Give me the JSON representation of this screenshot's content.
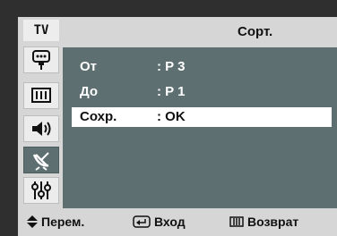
{
  "sidebar": {
    "source_label": "TV",
    "items": [
      {
        "icon": "picture-icon",
        "active": false
      },
      {
        "icon": "sound-icon",
        "active": false
      },
      {
        "icon": "channel-antenna-icon",
        "active": true
      },
      {
        "icon": "setup-sliders-icon",
        "active": false
      }
    ]
  },
  "header": {
    "title": "Сорт."
  },
  "rows": [
    {
      "label": "От",
      "value": ": P 3",
      "selected": false
    },
    {
      "label": "До",
      "value": ": P 1",
      "selected": false
    },
    {
      "label": "Сохр.",
      "value": ": OK",
      "selected": true
    }
  ],
  "footer": {
    "move": "Перем.",
    "enter": "Вход",
    "back": "Возврат"
  },
  "colors": {
    "panel": "#5d6f70",
    "chrome": "#d6d6d6",
    "highlight": "#ffffff"
  }
}
